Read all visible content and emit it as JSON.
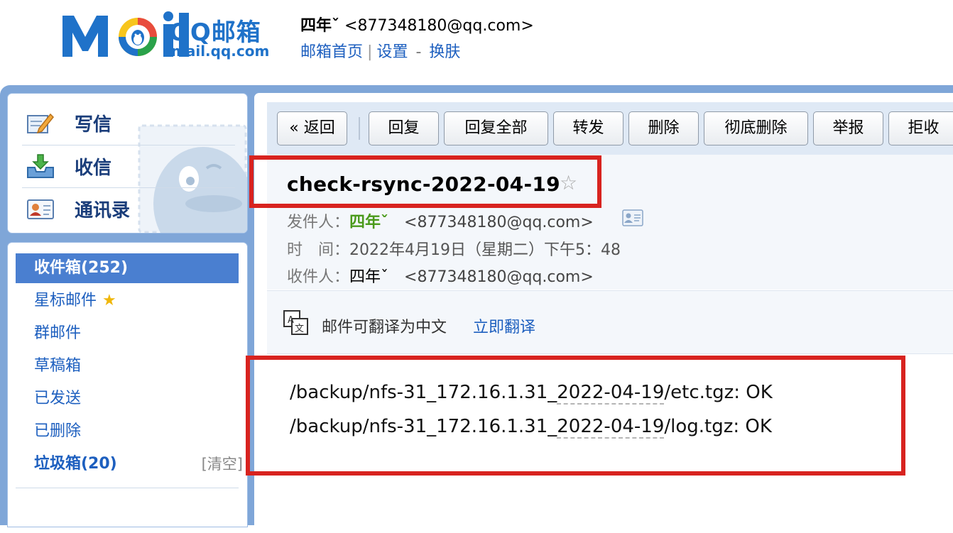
{
  "header": {
    "logo_text": "Mail",
    "product_name": "QQ邮箱",
    "product_url": "mail.qq.com",
    "user_name": "四年ˇ",
    "user_email": "<877348180@qq.com>",
    "nav": {
      "home": "邮箱首页",
      "settings": "设置",
      "dash": "-",
      "skin": "换肤"
    }
  },
  "sidebar": {
    "actions": [
      {
        "label": "写信",
        "icon": "compose-icon"
      },
      {
        "label": "收信",
        "icon": "inbox-download-icon"
      },
      {
        "label": "通讯录",
        "icon": "contacts-icon"
      }
    ],
    "folders": [
      {
        "label": "收件箱(252)",
        "active": true
      },
      {
        "label": "星标邮件",
        "star": "★"
      },
      {
        "label": "群邮件"
      },
      {
        "label": "草稿箱"
      },
      {
        "label": "已发送"
      },
      {
        "label": "已删除"
      },
      {
        "label": "垃圾箱(20)",
        "bold": true,
        "action": "[清空]"
      }
    ]
  },
  "toolbar": {
    "back": "« 返回",
    "reply": "回复",
    "reply_all": "回复全部",
    "forward": "转发",
    "delete": "删除",
    "delete_permanent": "彻底删除",
    "report": "举报",
    "reject": "拒收"
  },
  "email": {
    "subject": "check-rsync-2022-04-19",
    "star": "☆",
    "from_label": "发件人：",
    "from_name": "四年ˇ",
    "from_email": "<877348180@qq.com>",
    "time_label": "时　间：",
    "time_value": "2022年4月19日（星期二）下午5：48",
    "to_label": "收件人：",
    "to_name": "四年ˇ",
    "to_email": "<877348180@qq.com>",
    "translate_text": "邮件可翻译为中文",
    "translate_link": "立即翻译",
    "body": [
      {
        "pre": "/backup/nfs-31_172.16.1.31_",
        "date": "2022-04-19",
        "post": "/etc.tgz: OK"
      },
      {
        "pre": "/backup/nfs-31_172.16.1.31_",
        "date": "2022-04-19",
        "post": "/log.tgz: OK"
      }
    ]
  },
  "colors": {
    "brand_blue": "#1f72c9",
    "link_blue": "#1d5fbf",
    "frame_blue": "#7fa6d8",
    "active_folder": "#4a7fd0",
    "sender_green": "#4a9a1b",
    "annotation_red": "#d8231f"
  }
}
